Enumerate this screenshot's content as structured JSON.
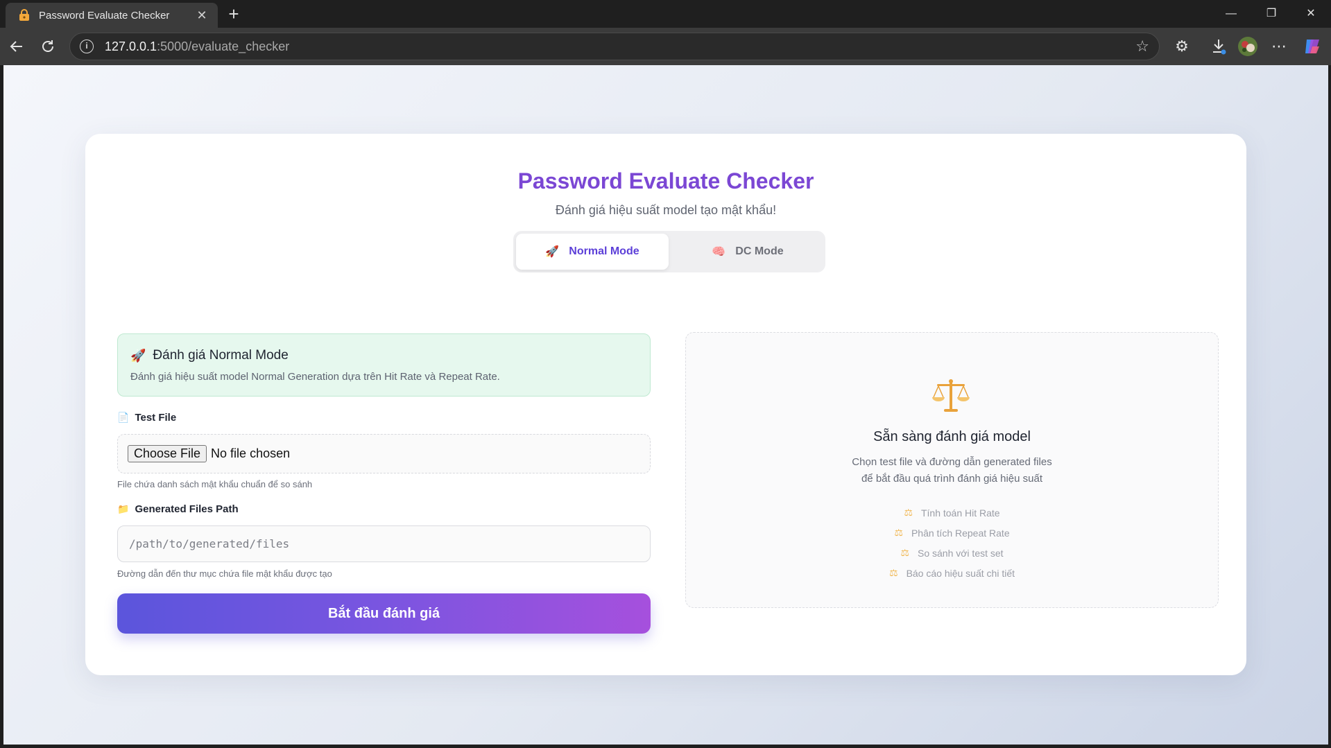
{
  "browser": {
    "tab_title": "Password Evaluate Checker",
    "url_host": "127.0.0.1",
    "url_path": ":5000/evaluate_checker"
  },
  "header": {
    "title": "Password Evaluate Checker",
    "subtitle": "Đánh giá hiệu suất model tạo mật khẩu!"
  },
  "modes": {
    "normal": {
      "label": "Normal Mode",
      "emoji": "🚀"
    },
    "dc": {
      "label": "DC Mode",
      "emoji": "🧠"
    }
  },
  "info": {
    "emoji": "🚀",
    "title": "Đánh giá Normal Mode",
    "description": "Đánh giá hiệu suất model Normal Generation dựa trên Hit Rate và Repeat Rate."
  },
  "form": {
    "test_file": {
      "emoji": "📄",
      "label": "Test File",
      "button_label": "Choose File",
      "status": "No file chosen",
      "hint": "File chứa danh sách mật khẩu chuẩn để so sánh"
    },
    "generated_path": {
      "emoji": "📁",
      "label": "Generated Files Path",
      "placeholder": "/path/to/generated/files",
      "hint": "Đường dẫn đến thư mục chứa file mật khẩu được tạo"
    },
    "submit_label": "Bắt đầu đánh giá"
  },
  "ready": {
    "icon": "scale-icon",
    "title": "Sẵn sàng đánh giá model",
    "desc_line1": "Chọn test file và đường dẫn generated files",
    "desc_line2": "để bắt đầu quá trình đánh giá hiệu suất",
    "features": [
      "Tính toán Hit Rate",
      "Phân tích Repeat Rate",
      "So sánh với test set",
      "Báo cáo hiệu suất chi tiết"
    ]
  },
  "colors": {
    "title": "#7b47d4",
    "active_mode": "#5c3fd8",
    "info_bg": "#e6f8ee",
    "button_start": "#5b55dc",
    "button_end": "#a650dd"
  }
}
